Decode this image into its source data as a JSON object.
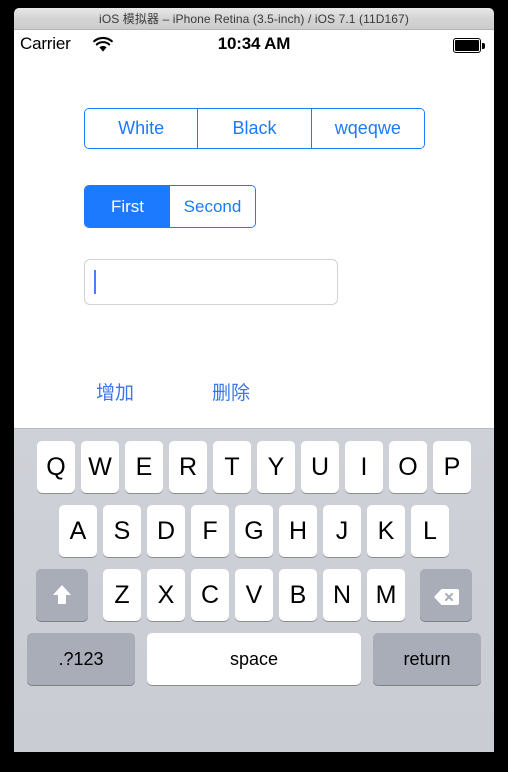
{
  "window": {
    "title": "iOS 模拟器 – iPhone Retina (3.5-inch) / iOS 7.1 (11D167)"
  },
  "status_bar": {
    "carrier": "Carrier",
    "wifi_icon": "wifi-icon",
    "time": "10:34 AM",
    "battery_icon": "battery-full-icon"
  },
  "content": {
    "segment_colors": {
      "options": [
        "White",
        "Black",
        "wqeqwe"
      ],
      "selected_index": -1
    },
    "segment_order": {
      "options": [
        "First",
        "Second"
      ],
      "selected_index": 0
    },
    "text_field": {
      "value": "",
      "placeholder": ""
    },
    "buttons": {
      "add": "增加",
      "delete": "删除"
    }
  },
  "keyboard": {
    "row1": [
      "Q",
      "W",
      "E",
      "R",
      "T",
      "Y",
      "U",
      "I",
      "O",
      "P"
    ],
    "row2": [
      "A",
      "S",
      "D",
      "F",
      "G",
      "H",
      "J",
      "K",
      "L"
    ],
    "row3_letters": [
      "Z",
      "X",
      "C",
      "V",
      "B",
      "N",
      "M"
    ],
    "shift_icon": "shift-arrow-icon",
    "backspace_icon": "backspace-delete-icon",
    "numbers_key": ".?123",
    "space_key": "space",
    "return_key": "return"
  },
  "colors": {
    "accent_blue": "#1c7aff",
    "button_blue": "#3b77e8",
    "keyboard_bg": "#c9ccd3",
    "key_white": "#ffffff",
    "key_gray": "#a9adb8",
    "caret_blue": "#4a7dfc"
  }
}
